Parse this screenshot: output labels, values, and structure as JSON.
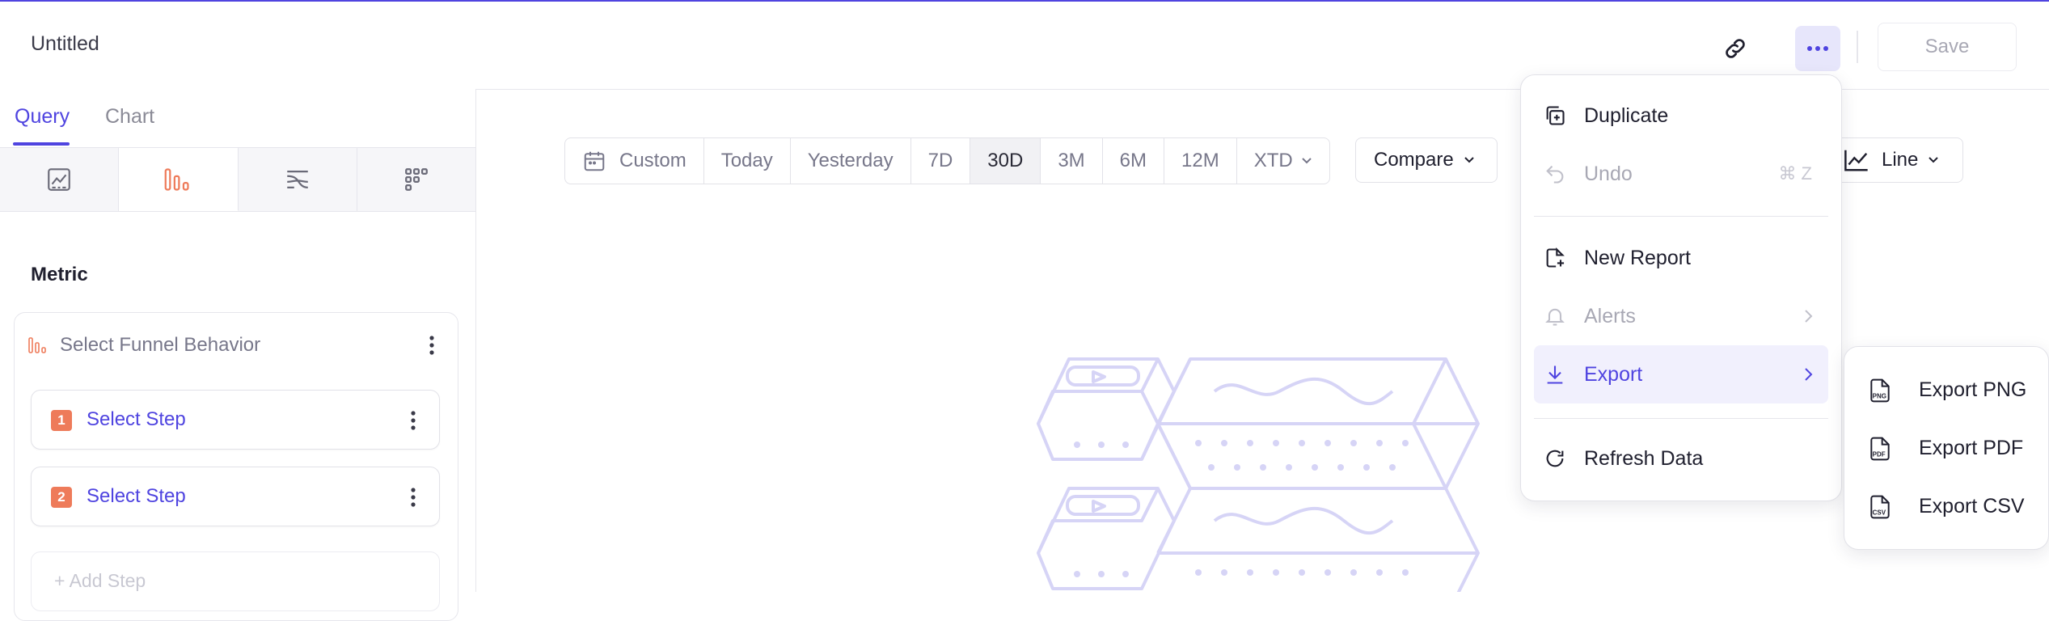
{
  "header": {
    "title": "Untitled",
    "save_label": "Save"
  },
  "left_panel": {
    "tabs": [
      {
        "label": "Query",
        "active": true
      },
      {
        "label": "Chart",
        "active": false
      }
    ],
    "chart_types": [
      "insights-icon",
      "funnels-icon",
      "flows-icon",
      "retention-icon"
    ],
    "metric_label": "Metric",
    "funnel_behavior": "Select Funnel Behavior",
    "steps": [
      {
        "number": "1",
        "label": "Select Step"
      },
      {
        "number": "2",
        "label": "Select Step"
      }
    ],
    "add_step": "Add Step"
  },
  "toolbar": {
    "date_ranges": [
      {
        "label": "Custom",
        "icon": "calendar-icon"
      },
      {
        "label": "Today"
      },
      {
        "label": "Yesterday"
      },
      {
        "label": "7D"
      },
      {
        "label": "30D",
        "selected": true
      },
      {
        "label": "3M"
      },
      {
        "label": "6M"
      },
      {
        "label": "12M"
      },
      {
        "label": "XTD",
        "dropdown": true
      }
    ],
    "compare_label": "Compare",
    "chart_type_label": "Line"
  },
  "menu": {
    "duplicate": "Duplicate",
    "undo": "Undo",
    "undo_shortcut": "⌘ Z",
    "new_report": "New Report",
    "alerts": "Alerts",
    "export": "Export",
    "refresh": "Refresh Data"
  },
  "export_submenu": {
    "png": "Export PNG",
    "pdf": "Export PDF",
    "csv": "Export CSV"
  },
  "colors": {
    "accent": "#4f44e0",
    "funnel": "#ee7b5a",
    "illustration": "#d9d7f7"
  }
}
